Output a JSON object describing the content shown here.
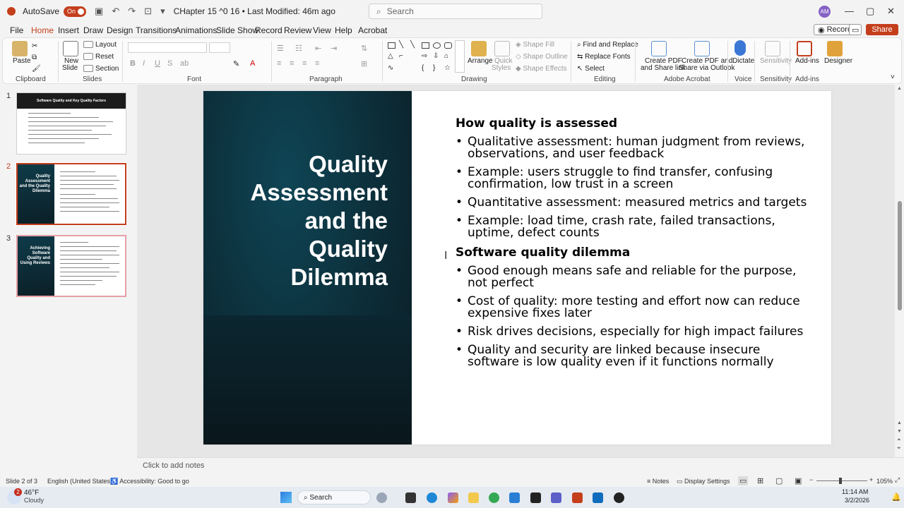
{
  "titlebar": {
    "autosave": "AutoSave",
    "toggle": "On",
    "doc_title": "CHapter 15 ^0 16  •  Last Modified: 46m ago",
    "search_placeholder": "Search",
    "avatar_initials": "AM"
  },
  "tabs": [
    "File",
    "Home",
    "Insert",
    "Draw",
    "Design",
    "Transitions",
    "Animations",
    "Slide Show",
    "Record",
    "Review",
    "View",
    "Help",
    "Acrobat"
  ],
  "tabs_right": {
    "record": "Record",
    "share": "Share"
  },
  "ribbon": {
    "clipboard": {
      "paste": "Paste",
      "label": "Clipboard"
    },
    "slides": {
      "new_slide": "New",
      "new_slide2": "Slide",
      "layout": "Layout",
      "reset": "Reset",
      "section": "Section",
      "label": "Slides"
    },
    "font": {
      "label": "Font"
    },
    "paragraph": {
      "label": "Paragraph"
    },
    "drawing": {
      "arrange": "Arrange",
      "quick_styles": "Quick",
      "quick_styles2": "Styles",
      "shape_fill": "Shape Fill",
      "shape_outline": "Shape Outline",
      "shape_effects": "Shape Effects",
      "label": "Drawing"
    },
    "editing": {
      "find": "Find and Replace",
      "replace_fonts": "Replace Fonts",
      "select": "Select",
      "label": "Editing"
    },
    "acrobat": {
      "create1a": "Create PDF",
      "create1b": "and Share link",
      "create2a": "Create PDF and",
      "create2b": "Share via Outlook",
      "label": "Adobe Acrobat"
    },
    "voice": {
      "dictate": "Dictate",
      "label": "Voice"
    },
    "sensitivity": {
      "btn": "Sensitivity",
      "label": "Sensitivity"
    },
    "addins": {
      "btn": "Add-ins",
      "label": "Add-ins"
    },
    "designer": {
      "btn": "Designer"
    }
  },
  "thumbnails": [
    {
      "num": "1",
      "title": "Software Quality and Key Quality Factors"
    },
    {
      "num": "2",
      "title": "Quality Assessment and the Quality Dilemma"
    },
    {
      "num": "3",
      "title": "Achieving Software Quality and Using Reviews"
    }
  ],
  "slide": {
    "title_lines": [
      "Quality",
      "Assessment",
      "and the",
      "Quality",
      "Dilemma"
    ],
    "heading1": "How quality is assessed",
    "bullets1": [
      "Qualitative assessment: human judgment from reviews, observations, and user feedback",
      "Example: users struggle to find transfer, confusing confirmation, low trust in a screen",
      "Quantitative assessment: measured metrics and targets",
      "Example: load time, crash rate, failed transactions, uptime, defect counts"
    ],
    "heading2": "Software quality dilemma",
    "bullets2": [
      "Good enough means safe and reliable for the purpose, not perfect",
      "Cost of quality: more testing and effort now can reduce expensive fixes later",
      "Risk drives decisions, especially for high impact failures",
      "Quality and security are linked because insecure software is low quality even if it functions normally"
    ]
  },
  "notes_placeholder": "Click to add notes",
  "status": {
    "slide": "Slide 2 of 3",
    "lang": "English (United States)",
    "access": "Accessibility: Good to go",
    "notes": "Notes",
    "display": "Display Settings",
    "zoom": "105%"
  },
  "taskbar": {
    "temp": "46°F",
    "weather": "Cloudy",
    "search": "Search",
    "time": "11:14 AM",
    "date": "3/2/2026",
    "badge": "2"
  }
}
